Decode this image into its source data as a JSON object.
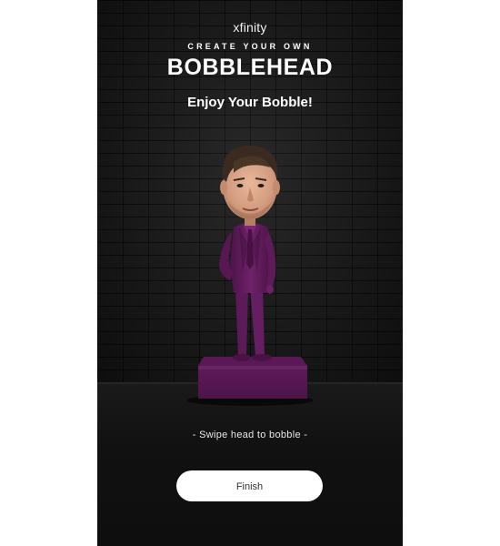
{
  "header": {
    "brand": "xfinity",
    "kicker": "CREATE YOUR OWN",
    "title": "BOBBLEHEAD",
    "subtitle": "Enjoy Your Bobble!"
  },
  "hint": "- Swipe head to bobble -",
  "actions": {
    "finish_label": "Finish"
  },
  "colors": {
    "background": "#161616",
    "suit": "#6a1f66",
    "button": "#ffffff"
  },
  "icons": {
    "figure": "bobblehead-figure"
  }
}
